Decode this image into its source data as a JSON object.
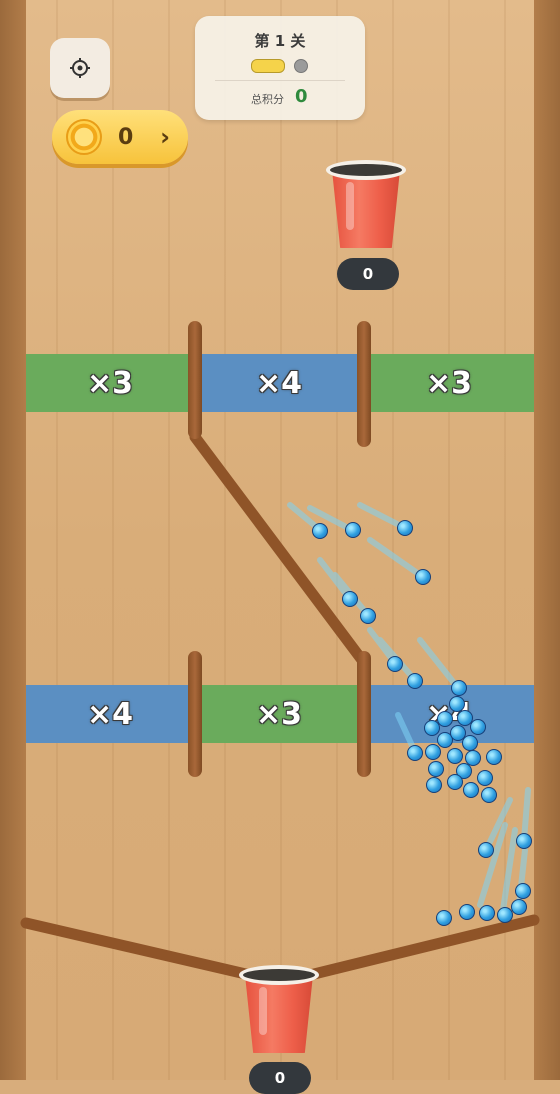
{
  "hud": {
    "settings_icon": "gear-icon",
    "coins": "0",
    "coin_icon": "coin-icon",
    "coin_arrow": "›",
    "level_title": "第 1 关",
    "level_progress_filled": 1,
    "level_progress_total": 2,
    "score_label": "总积分",
    "score_value": "0"
  },
  "cups": {
    "top_count": "0",
    "bottom_count": "0"
  },
  "zones": {
    "row1": [
      "×3",
      "×4",
      "×3"
    ],
    "row2": [
      "×4",
      "×3",
      "×4"
    ]
  },
  "colors": {
    "green_zone": "#6aab5c",
    "blue_zone": "#5b8fc2",
    "cup": "#ee5f4a",
    "ball": "#2f9fe0",
    "coin_pill": "#f7c33b",
    "score_value": "#2f8a3d"
  }
}
